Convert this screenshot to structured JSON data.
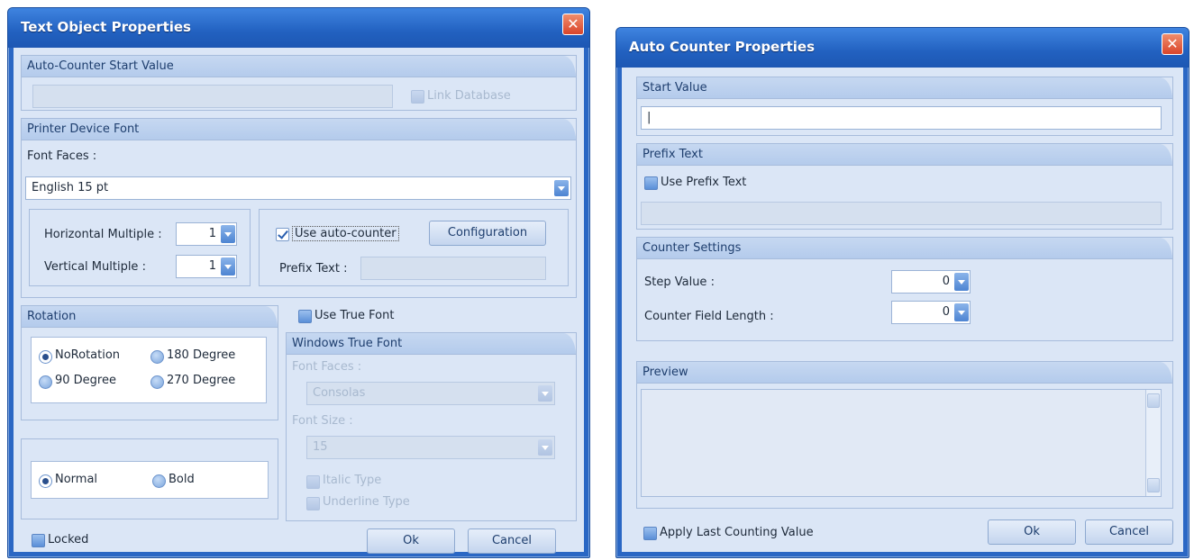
{
  "text_dialog": {
    "title": "Text Object Properties",
    "auto_counter": {
      "header": "Auto-Counter Start Value",
      "value": "",
      "link_database": "Link Database"
    },
    "printer_font": {
      "header": "Printer Device Font",
      "font_faces_label": "Font Faces :",
      "font_faces_value": "English 15 pt",
      "horizontal_label": "Horizontal Multiple :",
      "horizontal_value": "1",
      "vertical_label": "Vertical Multiple :",
      "vertical_value": "1",
      "use_auto_counter": "Use auto-counter",
      "configuration": "Configuration",
      "prefix_label": "Prefix Text :",
      "prefix_value": ""
    },
    "rotation": {
      "header": "Rotation",
      "options": [
        "NoRotation",
        "180 Degree",
        "90 Degree",
        "270 Degree"
      ],
      "selected": "NoRotation"
    },
    "weight": {
      "options": [
        "Normal",
        "Bold"
      ],
      "selected": "Normal"
    },
    "use_true_font": "Use True Font",
    "true_font": {
      "header": "Windows True Font",
      "font_faces_label": "Font Faces :",
      "font_faces_value": "Consolas",
      "font_size_label": "Font Size :",
      "font_size_value": "15",
      "italic": "Italic Type",
      "underline": "Underline Type"
    },
    "locked": "Locked",
    "ok": "Ok",
    "cancel": "Cancel"
  },
  "counter_dialog": {
    "title": "Auto Counter Properties",
    "start": {
      "header": "Start Value",
      "value": "|"
    },
    "prefix": {
      "header": "Prefix Text",
      "use_prefix": "Use Prefix Text",
      "value": ""
    },
    "settings": {
      "header": "Counter Settings",
      "step_label": "Step Value :",
      "step_value": "0",
      "length_label": "Counter Field Length :",
      "length_value": "0"
    },
    "preview": {
      "header": "Preview"
    },
    "apply_last": "Apply Last Counting Value",
    "ok": "Ok",
    "cancel": "Cancel"
  }
}
